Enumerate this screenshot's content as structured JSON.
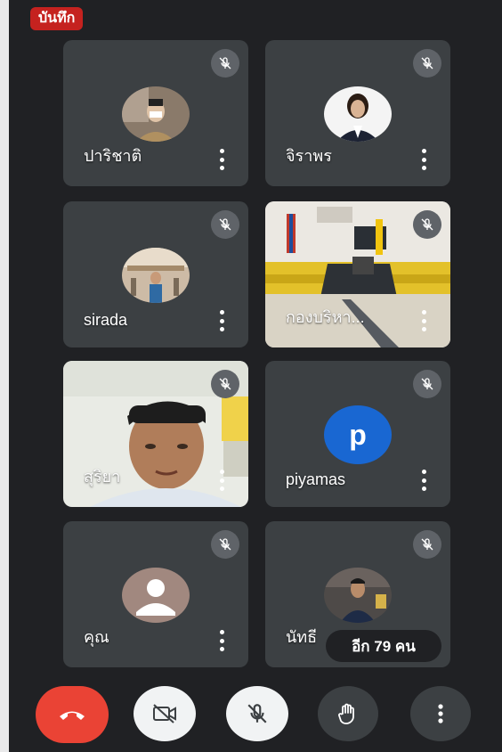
{
  "recording": {
    "label": "บันทึก"
  },
  "participants": [
    {
      "name": "ปาริชาติ",
      "tile": "photo"
    },
    {
      "name": "จิราพร",
      "tile": "photo"
    },
    {
      "name": "sirada",
      "tile": "photo"
    },
    {
      "name": "กองบริหา...",
      "tile": "video"
    },
    {
      "name": "สุริยา",
      "tile": "video"
    },
    {
      "name": "piyamas",
      "tile": "letter",
      "initial": "p"
    },
    {
      "name": "คุณ",
      "tile": "default-avatar"
    },
    {
      "name": "นัทธี",
      "tile": "photo"
    }
  ],
  "more_participants": {
    "label": "อีก 79 คน"
  },
  "controls": [
    "end-call",
    "camera-off",
    "mic-off",
    "raise-hand",
    "more-options"
  ],
  "colors": {
    "background": "#202124",
    "tile": "#3c4043",
    "end_call": "#ea4335",
    "avatar_letter": "#1967d2"
  }
}
